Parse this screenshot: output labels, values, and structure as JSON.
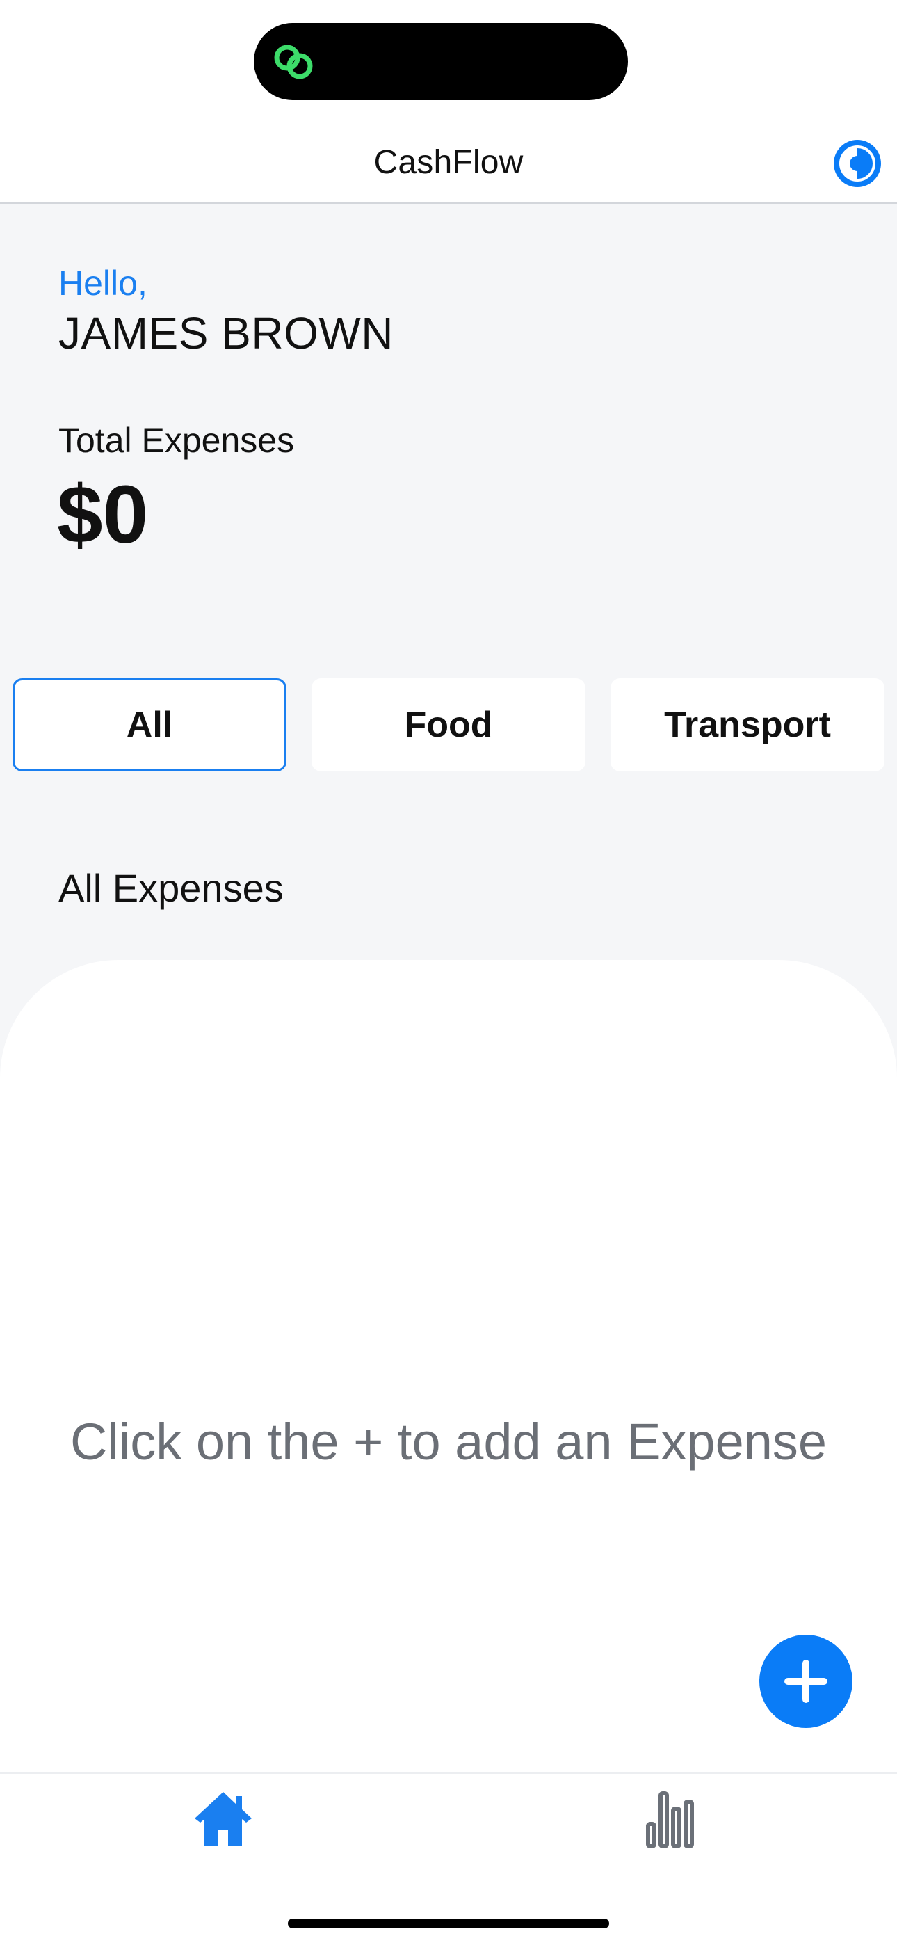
{
  "app": {
    "title": "CashFlow"
  },
  "greeting": {
    "hello": "Hello,",
    "name": "JAMES BROWN"
  },
  "summary": {
    "total_label": "Total Expenses",
    "total_value": "$0"
  },
  "filters": [
    {
      "label": "All",
      "active": true
    },
    {
      "label": "Food",
      "active": false
    },
    {
      "label": "Transport",
      "active": false
    }
  ],
  "list": {
    "title": "All Expenses",
    "empty_message": "Click on the + to add an Expense"
  },
  "tabs": [
    {
      "icon": "home-icon",
      "active": true
    },
    {
      "icon": "chart-icon",
      "active": false
    }
  ],
  "colors": {
    "accent": "#1a7ff0",
    "fab": "#0a7cf7",
    "island_icon": "#3ddc6a",
    "muted_text": "#6b6f76",
    "inactive_icon": "#6b7078"
  }
}
